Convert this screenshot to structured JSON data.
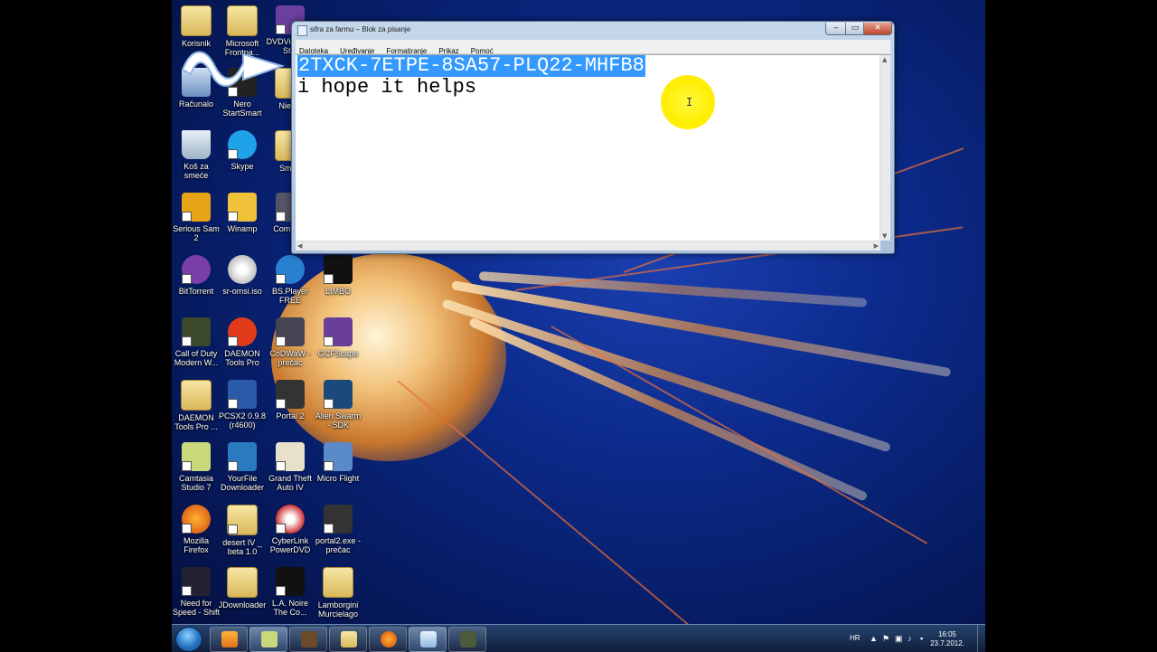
{
  "desktop": {
    "icons": [
      {
        "label": "Korisnik"
      },
      {
        "label": "Microsoft Frontpa..."
      },
      {
        "label": "DVDVid Free St..."
      },
      {
        "label": "Računalo"
      },
      {
        "label": "Nero StartSmart"
      },
      {
        "label": "Nieuw"
      },
      {
        "label": "Koš za smeće"
      },
      {
        "label": "Skype"
      },
      {
        "label": "Smart"
      },
      {
        "label": "Serious Sam 2"
      },
      {
        "label": "Winamp"
      },
      {
        "label": "Com Arm"
      },
      {
        "label": "BitTorrent"
      },
      {
        "label": "sr-omsi.iso"
      },
      {
        "label": "BS.Player FREE"
      },
      {
        "label": "LIMBO"
      },
      {
        "label": "Call of Duty Modern W..."
      },
      {
        "label": "DAEMON Tools Pro"
      },
      {
        "label": "CoDWaW - prečac"
      },
      {
        "label": "GCFScape"
      },
      {
        "label": "DAEMON Tools Pro ..."
      },
      {
        "label": "PCSX2 0.9.8 (r4600)"
      },
      {
        "label": "Portal 2"
      },
      {
        "label": "Alien Swarm - SDK"
      },
      {
        "label": "Camtasia Studio 7"
      },
      {
        "label": "YourFile Downloader"
      },
      {
        "label": "Grand Theft Auto IV"
      },
      {
        "label": "Micro Flight"
      },
      {
        "label": "Mozilla Firefox"
      },
      {
        "label": "desert IV _ beta 1.0"
      },
      {
        "label": "CyberLink PowerDVD"
      },
      {
        "label": "portal2.exe - prečac"
      },
      {
        "label": "Need for Speed - Shift"
      },
      {
        "label": "JDownloader"
      },
      {
        "label": "L.A. Noire The Co..."
      },
      {
        "label": "Lamborgini Murcielago"
      }
    ]
  },
  "notepad": {
    "title": "sifra za farmu – Blok za pisanje",
    "controls": {
      "minimize": "‒",
      "maximize": "▭",
      "close": "✕"
    },
    "menu": [
      "Datoteka",
      "Uređivanje",
      "Formatiranje",
      "Prikaz",
      "Pomoć"
    ],
    "lines": [
      "2TXCK-7ETPE-8SA57-PLQ22-MHFB8",
      "i hope it helps"
    ],
    "cursor": "I"
  },
  "taskbar": {
    "language": "HR",
    "time": "16:05",
    "date": "23.7.2012."
  },
  "colors": {
    "selection": "#3399ff",
    "desktop_bg": "#0b2a8a",
    "cursor_highlight": "#ffee00"
  }
}
